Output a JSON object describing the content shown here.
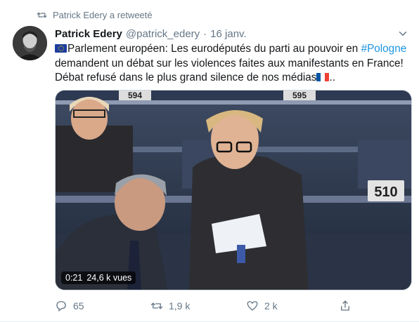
{
  "context": {
    "text": "Patrick Edery a retweeté",
    "icon": "retweet-icon"
  },
  "author": {
    "name": "Patrick Edery",
    "handle": "@patrick_edery",
    "separator": "·",
    "date": "16 janv."
  },
  "tweet": {
    "part1": "Parlement européen: Les eurodéputés du parti au pouvoir en ",
    "hashtag": "#Pologne",
    "part2": " demandent un débat sur les violences faites aux manifestants en France! Débat refusé dans le plus grand silence de nos médias",
    "part3": ".."
  },
  "media": {
    "duration": "0:21",
    "views": "24,6 k vues",
    "seat_labels": [
      "594",
      "595",
      "510"
    ]
  },
  "actions": {
    "reply": {
      "icon": "reply-icon",
      "count": "65"
    },
    "retweet": {
      "icon": "retweet-icon",
      "count": "1,9 k"
    },
    "like": {
      "icon": "heart-icon",
      "count": "2 k"
    },
    "share": {
      "icon": "share-icon"
    }
  },
  "colors": {
    "accent": "#1b95e0",
    "muted": "#657786",
    "text": "#14171a"
  }
}
